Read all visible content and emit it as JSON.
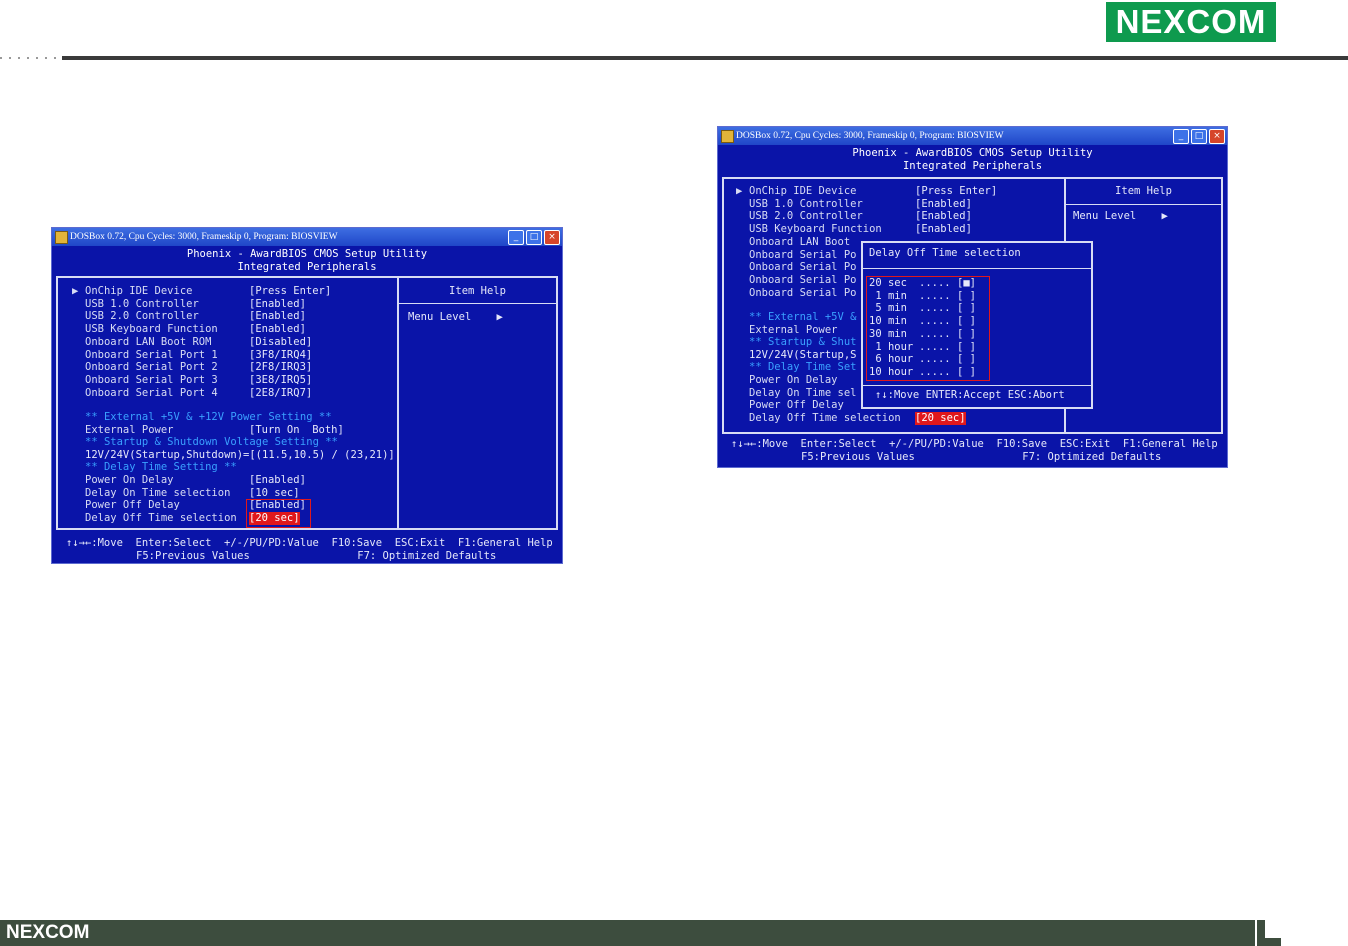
{
  "header": {
    "logo": "NEXCOM"
  },
  "footer": {
    "logo": "NEXCOM"
  },
  "left_window": {
    "title": "DOSBox 0.72, Cpu Cycles:     3000, Frameskip  0, Program:  BIOSVIEW",
    "bios_title": "Phoenix - AwardBIOS CMOS Setup Utility",
    "bios_subtitle": "Integrated Peripherals",
    "items": [
      {
        "marker": "▶",
        "label": "OnChip IDE Device",
        "value": "[Press Enter]"
      },
      {
        "marker": "",
        "label": "USB 1.0 Controller",
        "value": "[Enabled]"
      },
      {
        "marker": "",
        "label": "USB 2.0 Controller",
        "value": "[Enabled]"
      },
      {
        "marker": "",
        "label": "USB Keyboard Function",
        "value": "[Enabled]"
      },
      {
        "marker": "",
        "label": "Onboard LAN Boot ROM",
        "value": "[Disabled]"
      },
      {
        "marker": "",
        "label": "Onboard Serial Port 1",
        "value": "[3F8/IRQ4]"
      },
      {
        "marker": "",
        "label": "Onboard Serial Port 2",
        "value": "[2F8/IRQ3]"
      },
      {
        "marker": "",
        "label": "Onboard Serial Port 3",
        "value": "[3E8/IRQ5]"
      },
      {
        "marker": "",
        "label": "Onboard Serial Port 4",
        "value": "[2E8/IRQ7]"
      }
    ],
    "section_power": "** External +5V & +12V Power Setting **",
    "external_power_label": "External Power",
    "external_power_value": "[Turn On  Both]",
    "section_voltage": "** Startup & Shutdown Voltage Setting **",
    "voltage_line": "12V/24V(Startup,Shutdown)=[(11.5,10.5) / (23,21)]",
    "section_delay": "** Delay Time Setting **",
    "delay_items": [
      {
        "label": "Power On Delay",
        "value": "[Enabled]"
      },
      {
        "label": "Delay On Time selection",
        "value": "[10 sec]"
      },
      {
        "label": "Power Off Delay",
        "value": "[Enabled]"
      },
      {
        "label": "Delay Off Time selection",
        "value": "[20 sec]"
      }
    ],
    "help_title": "Item Help",
    "help_menu_level": "Menu Level",
    "help_arrow": "▶",
    "legend_line1": "↑↓→←:Move  Enter:Select  +/-/PU/PD:Value  F10:Save  ESC:Exit  F1:General Help",
    "legend_line2": "F5:Previous Values                 F7: Optimized Defaults"
  },
  "right_window": {
    "title": "DOSBox 0.72, Cpu Cycles:     3000, Frameskip  0, Program:  BIOSVIEW",
    "bios_title": "Phoenix - AwardBIOS CMOS Setup Utility",
    "bios_subtitle": "Integrated Peripherals",
    "items": [
      {
        "marker": "▶",
        "label": "OnChip IDE Device",
        "value": "[Press Enter]"
      },
      {
        "marker": "",
        "label": "USB 1.0 Controller",
        "value": "[Enabled]"
      },
      {
        "marker": "",
        "label": "USB 2.0 Controller",
        "value": "[Enabled]"
      },
      {
        "marker": "",
        "label": "USB Keyboard Function",
        "value": "[Enabled]"
      },
      {
        "marker": "",
        "label": "Onboard LAN Boot",
        "value": ""
      },
      {
        "marker": "",
        "label": "Onboard Serial Po",
        "value": ""
      },
      {
        "marker": "",
        "label": "Onboard Serial Po",
        "value": ""
      },
      {
        "marker": "",
        "label": "Onboard Serial Po",
        "value": ""
      },
      {
        "marker": "",
        "label": "Onboard Serial Po",
        "value": ""
      }
    ],
    "section_power": "** External +5V &",
    "external_power_label": "External Power",
    "section_voltage": "** Startup & Shut",
    "voltage_line": "12V/24V(Startup,S",
    "section_delay": "** Delay Time Set",
    "delay_items": [
      {
        "label": "Power On Delay",
        "value": ""
      },
      {
        "label": "Delay On Time sel",
        "value": ""
      },
      {
        "label": "Power Off Delay",
        "value": ""
      },
      {
        "label": "Delay Off Time selection",
        "value": "[20 sec]"
      }
    ],
    "help_title": "Item Help",
    "help_menu_level": "Menu Level",
    "help_arrow": "▶",
    "popup": {
      "title": "Delay Off Time selection",
      "options": [
        {
          "label": "20 sec",
          "dots": ".....",
          "mark": "[■]"
        },
        {
          "label": " 1 min",
          "dots": ".....",
          "mark": "[ ]"
        },
        {
          "label": " 5 min",
          "dots": ".....",
          "mark": "[ ]"
        },
        {
          "label": "10 min",
          "dots": ".....",
          "mark": "[ ]"
        },
        {
          "label": "30 min",
          "dots": ".....",
          "mark": "[ ]"
        },
        {
          "label": " 1 hour",
          "dots": ".....",
          "mark": "[ ]"
        },
        {
          "label": " 6 hour",
          "dots": ".....",
          "mark": "[ ]"
        },
        {
          "label": "10 hour",
          "dots": ".....",
          "mark": "[ ]"
        }
      ],
      "footer": "↑↓:Move ENTER:Accept ESC:Abort"
    },
    "legend_line1": "↑↓→←:Move  Enter:Select  +/-/PU/PD:Value  F10:Save  ESC:Exit  F1:General Help",
    "legend_line2": "F5:Previous Values                 F7: Optimized Defaults"
  },
  "colors": {
    "bios_blue": "#0a14a8",
    "frame": "#d8dcf4",
    "section_cyan": "#3aa0ff",
    "highlight_red": "#e0181c",
    "nexcom_green": "#0e9a4e",
    "footer_bar": "#3d4d3e"
  }
}
